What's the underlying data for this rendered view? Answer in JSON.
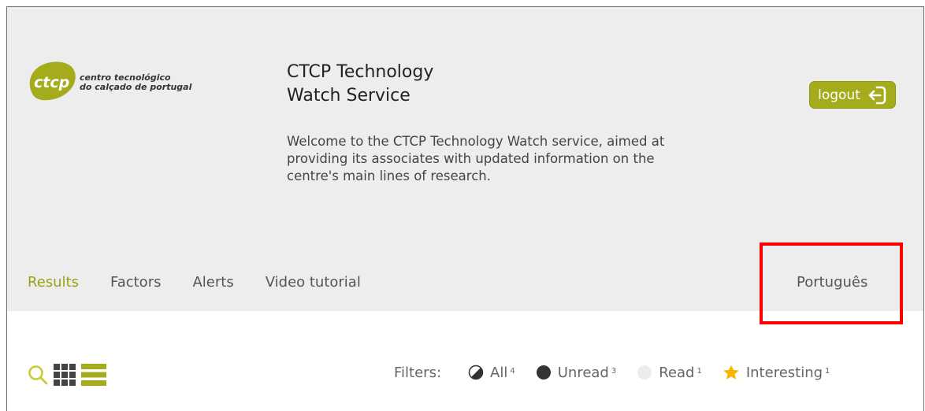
{
  "brand": {
    "logo_mark": "ctcp",
    "logo_line1": "centro tecnológico",
    "logo_line2": "do calçado de portugal",
    "accent_color": "#a4ac1c"
  },
  "header": {
    "title_line1": "CTCP Technology",
    "title_line2": "Watch Service",
    "welcome_line1": "Welcome to the CTCP Technology Watch service, aimed at",
    "welcome_line2": "providing its associates with updated information on the",
    "welcome_line3": "centre's main lines of research.",
    "logout_label": "logout"
  },
  "nav": {
    "items": [
      {
        "label": "Results",
        "active": true
      },
      {
        "label": "Factors"
      },
      {
        "label": "Alerts"
      },
      {
        "label": "Video tutorial"
      }
    ],
    "language": "Português"
  },
  "toolbar": {
    "icons": [
      "search-icon",
      "grid-view-icon",
      "list-view-icon"
    ]
  },
  "filters": {
    "label": "Filters:",
    "items": [
      {
        "label": "All",
        "count": "4",
        "icon": "half-circle-icon"
      },
      {
        "label": "Unread",
        "count": "3",
        "icon": "filled-circle-icon"
      },
      {
        "label": "Read",
        "count": "1",
        "icon": "empty-circle-icon"
      },
      {
        "label": "Interesting",
        "count": "1",
        "icon": "star-icon"
      }
    ]
  }
}
